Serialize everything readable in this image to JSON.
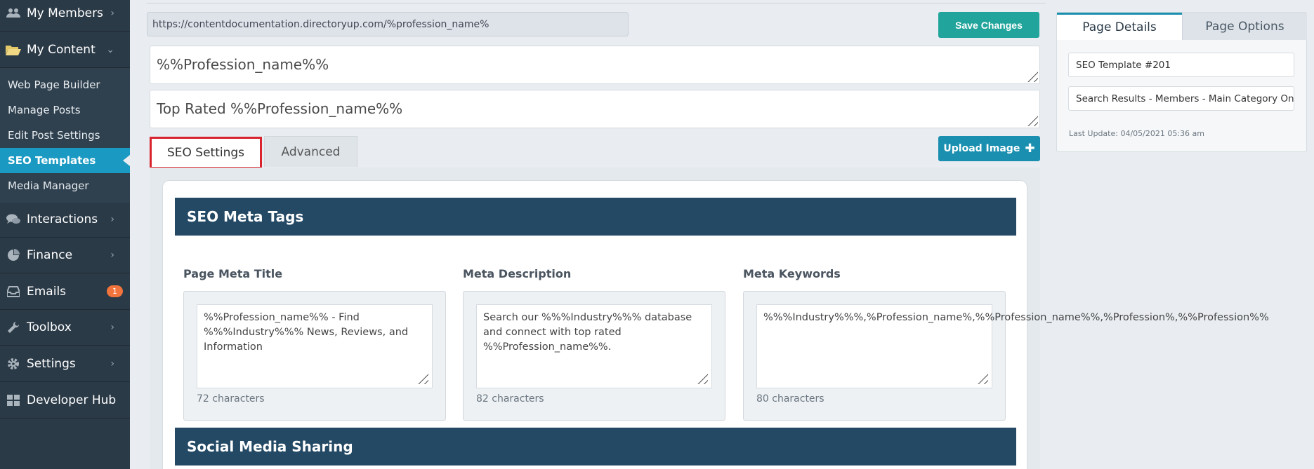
{
  "sidebar": {
    "my_members": "My Members",
    "my_content": "My Content",
    "sub_items": [
      {
        "label": "Web Page Builder"
      },
      {
        "label": "Manage Posts"
      },
      {
        "label": "Edit Post Settings"
      },
      {
        "label": "SEO Templates"
      },
      {
        "label": "Media Manager"
      }
    ],
    "interactions": "Interactions",
    "finance": "Finance",
    "emails": "Emails",
    "emails_badge": "1",
    "toolbox": "Toolbox",
    "settings": "Settings",
    "developer_hub": "Developer Hub"
  },
  "header": {
    "url": "https://contentdocumentation.directoryup.com/%profession_name%",
    "save_label": "Save Changes"
  },
  "template": {
    "name": "%%Profession_name%%",
    "title": "Top Rated %%Profession_name%%"
  },
  "tabs": {
    "seo": "SEO Settings",
    "advanced": "Advanced",
    "upload_label": "Upload Image"
  },
  "meta_section": {
    "heading": "SEO Meta Tags",
    "fields": [
      {
        "label": "Page Meta Title",
        "value": "%%Profession_name%% - Find %%%Industry%%% News, Reviews, and Information",
        "count": "72 characters"
      },
      {
        "label": "Meta Description",
        "value": "Search our %%%Industry%%% database and connect with top rated %%Profession_name%%.",
        "count": "82 characters"
      },
      {
        "label": "Meta Keywords",
        "value": "%%%Industry%%%,%Profession_name%,%%Profession_name%%,%Profession%,%%Profession%%",
        "count": "80 characters"
      }
    ]
  },
  "social_section": {
    "heading": "Social Media Sharing"
  },
  "right_panel": {
    "tab_details": "Page Details",
    "tab_options": "Page Options",
    "template_name": "SEO Template #201",
    "page_type": "Search Results - Members - Main Category Only",
    "last_update": "Last Update: 04/05/2021 05:36 am"
  }
}
